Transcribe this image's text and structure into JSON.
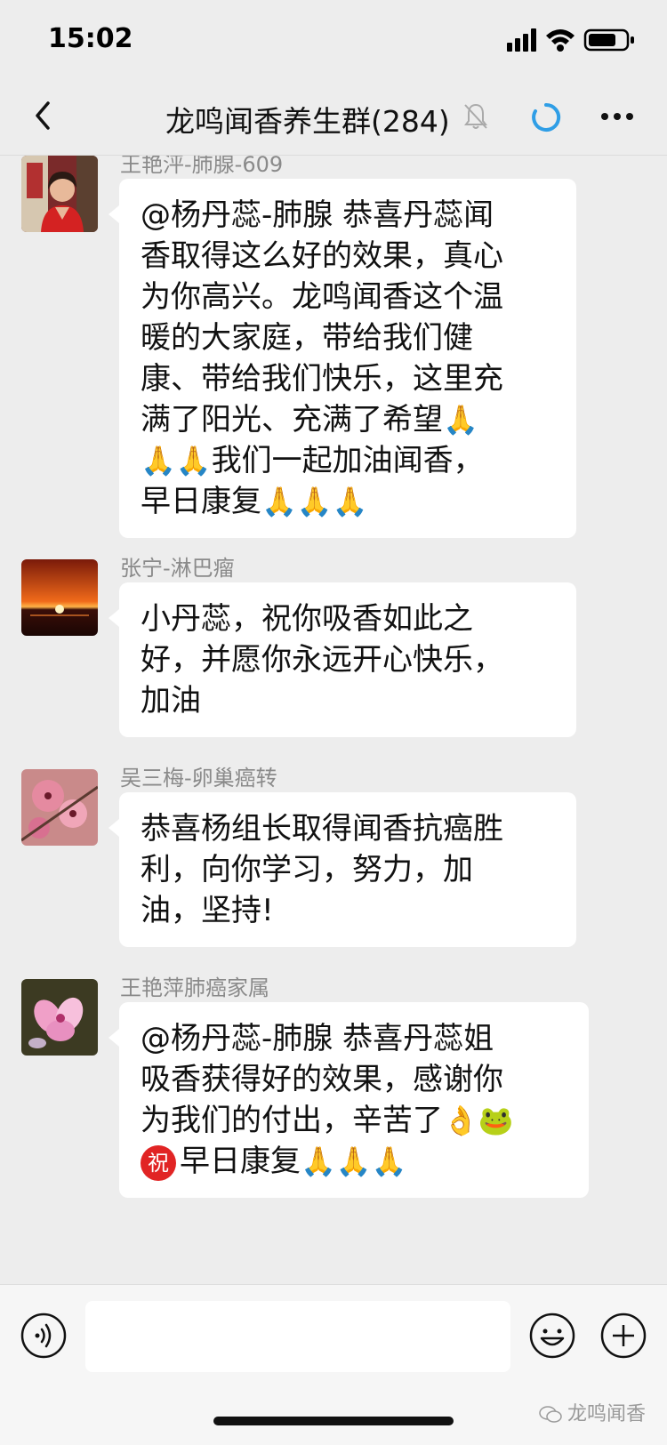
{
  "status_bar": {
    "time": "15:02"
  },
  "nav": {
    "title": "龙鸣闻香养生群(284)"
  },
  "messages": [
    {
      "sender": "王艳泙-肺腺-609",
      "lines": [
        "@杨丹蕊-肺腺 恭喜丹蕊闻",
        "香取得这么好的效果，真心",
        "为你高兴。龙鸣闻香这个温",
        "暖的大家庭，带给我们健",
        "康、带给我们快乐，这里充",
        "满了阳光、充满了希望",
        "我们一起加油闻香，",
        "早日康复"
      ]
    },
    {
      "sender": "张宁-淋巴瘤",
      "lines": [
        "小丹蕊，祝你吸香如此之",
        "好，并愿你永远开心快乐，",
        "加油"
      ]
    },
    {
      "sender": "吴三梅-卵巢癌转",
      "lines": [
        "恭喜杨组长取得闻香抗癌胜",
        "利，向你学习，努力，加",
        "油，坚持!"
      ]
    },
    {
      "sender": "王艳萍肺癌家属",
      "lines": [
        "@杨丹蕊-肺腺 恭喜丹蕊姐",
        "吸香获得好的效果，感谢你",
        "为我们的付出，辛苦了",
        "早日康复"
      ],
      "zhu_badge": "祝"
    }
  ],
  "emoji": {
    "pray": "🙏",
    "clap": "👌",
    "frog": "🐸"
  },
  "watermark": "龙鸣闻香"
}
